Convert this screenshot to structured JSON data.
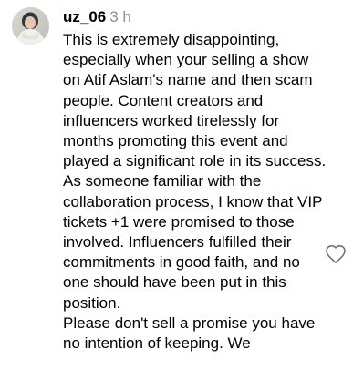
{
  "comment": {
    "username": "uz_06",
    "timestamp": "3 h",
    "avatar_icon": "user-avatar",
    "paragraphs": [
      "This is extremely disappointing, especially when your selling a show on Atif Aslam's name and then scam people. Content creators and influencers worked tirelessly for months promoting this event and played a significant role in its success.",
      "As someone familiar with the collaboration process, I know that VIP tickets +1 were promised to those involved. Influencers fulfilled their commitments in good faith, and no one should have been put in this position.",
      "Please don't sell a promise you have no intention of keeping. We"
    ],
    "like_icon": "heart-outline-icon"
  }
}
